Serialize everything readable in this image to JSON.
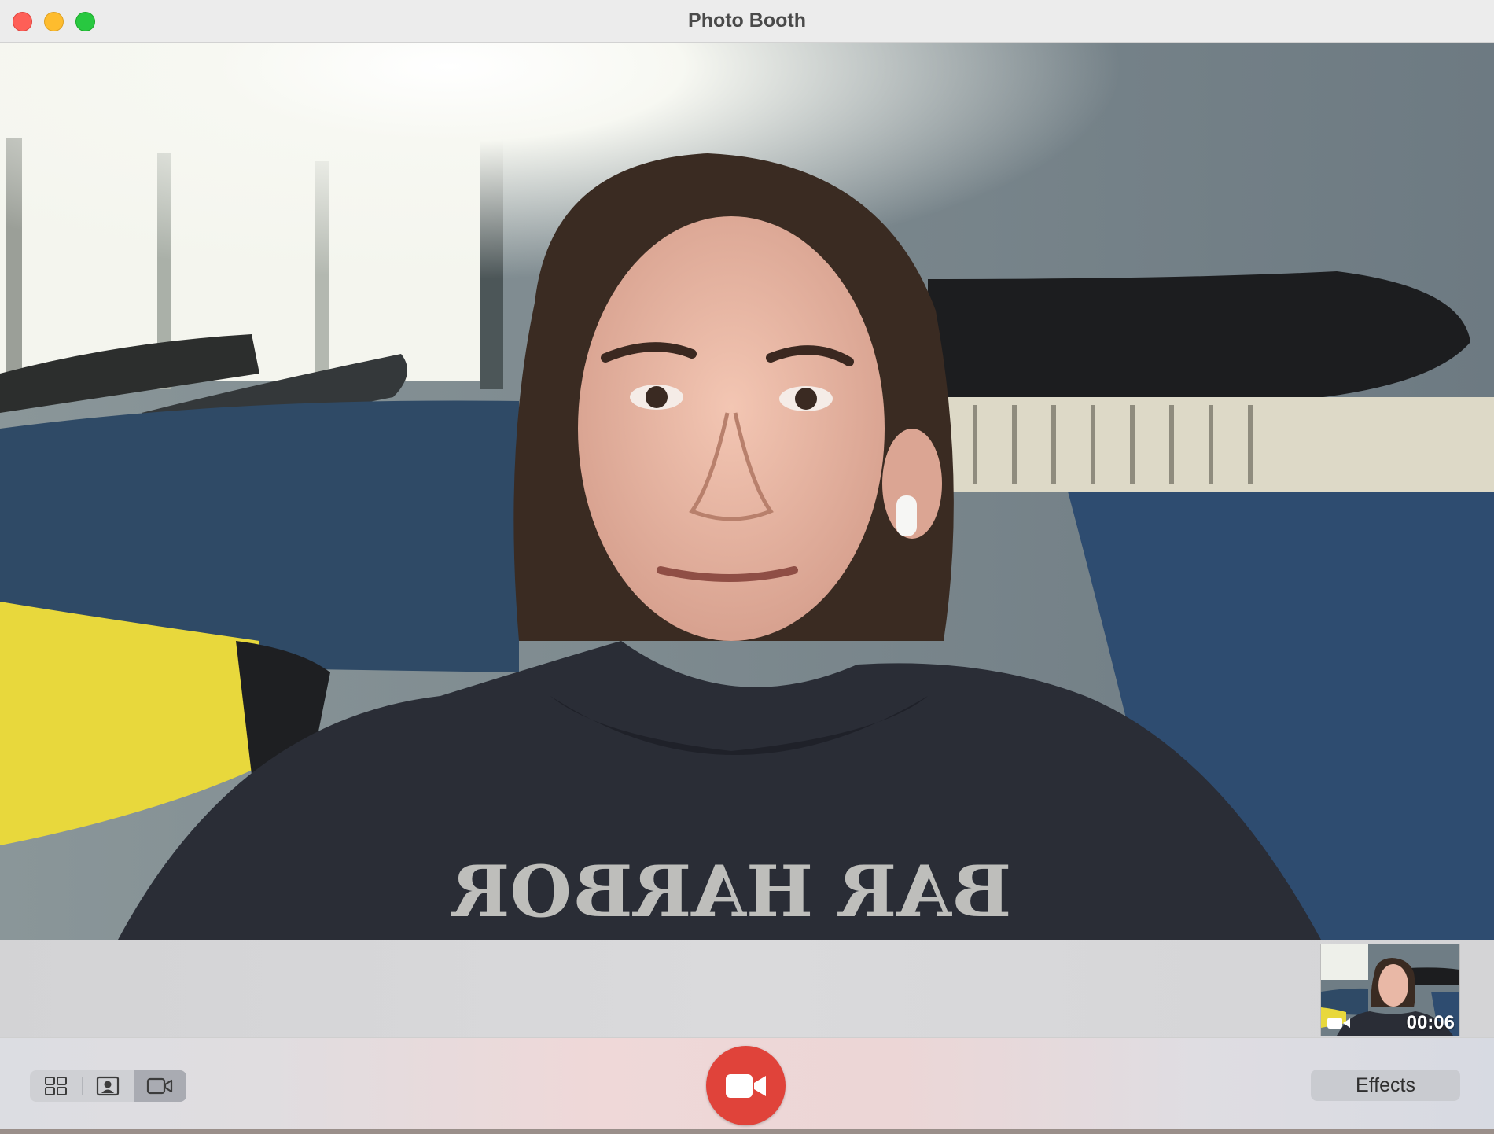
{
  "window": {
    "title": "Photo Booth"
  },
  "traffic_lights": {
    "close_color": "#fe5f57",
    "minimize_color": "#febc2e",
    "maximize_color": "#28c840"
  },
  "preview": {
    "sweatshirt_print": "BAR HARBOR"
  },
  "filmstrip": {
    "items": [
      {
        "type": "video",
        "icon": "video-camera-icon",
        "duration": "00:06"
      }
    ]
  },
  "toolbar": {
    "modes": [
      {
        "name": "grid",
        "icon": "four-up-grid-icon",
        "active": false
      },
      {
        "name": "photo",
        "icon": "portrait-photo-icon",
        "active": false
      },
      {
        "name": "video",
        "icon": "video-camera-icon",
        "active": true
      }
    ],
    "record_icon": "video-camera-icon",
    "record_color": "#e0433a",
    "effects_label": "Effects"
  }
}
